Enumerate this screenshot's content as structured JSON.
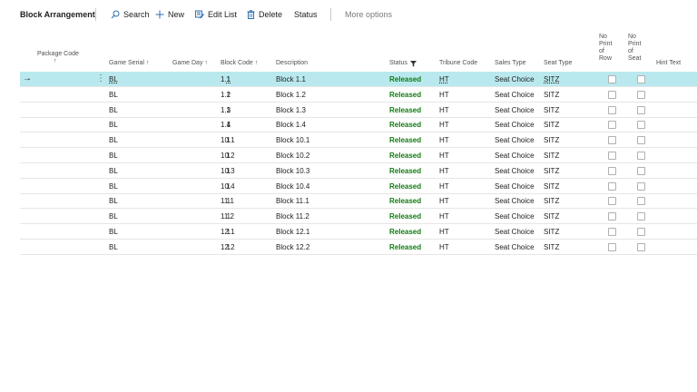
{
  "page": {
    "title": "Block Arrangement"
  },
  "toolbar": {
    "search_label": "Search",
    "new_label": "New",
    "edit_list_label": "Edit List",
    "delete_label": "Delete",
    "status_label": "Status",
    "more_options_label": "More options"
  },
  "colors": {
    "accent": "#2f6fb0",
    "selected_row": "#b9e9ee",
    "released": "#107c10"
  },
  "columns": {
    "package_code": "Package Code",
    "package_code_sort": "↑",
    "game_serial": "Game Serial ↑",
    "game_day": "Game Day ↑",
    "block_code": "Block Code ↑",
    "description": "Description",
    "status": "Status",
    "tribune_code": "Tribune Code",
    "sales_type": "Sales Type",
    "seat_type": "Seat Type",
    "no_print_row": [
      "No",
      "Print",
      "of",
      "Row"
    ],
    "no_print_seat": [
      "No",
      "Print",
      "of",
      "Seat"
    ],
    "hint_text": "Hint Text"
  },
  "rows": [
    {
      "serial": "BL",
      "day": "1",
      "block": "1.1",
      "desc": "Block 1.1",
      "status": "Released",
      "tribune": "HT",
      "sales": "Seat Choice",
      "seat": "SITZ"
    },
    {
      "serial": "BL",
      "day": "1",
      "block": "1.2",
      "desc": "Block 1.2",
      "status": "Released",
      "tribune": "HT",
      "sales": "Seat Choice",
      "seat": "SITZ"
    },
    {
      "serial": "BL",
      "day": "1",
      "block": "1.3",
      "desc": "Block 1.3",
      "status": "Released",
      "tribune": "HT",
      "sales": "Seat Choice",
      "seat": "SITZ"
    },
    {
      "serial": "BL",
      "day": "1",
      "block": "1.4",
      "desc": "Block 1.4",
      "status": "Released",
      "tribune": "HT",
      "sales": "Seat Choice",
      "seat": "SITZ"
    },
    {
      "serial": "BL",
      "day": "1",
      "block": "10.1",
      "desc": "Block 10.1",
      "status": "Released",
      "tribune": "HT",
      "sales": "Seat Choice",
      "seat": "SITZ"
    },
    {
      "serial": "BL",
      "day": "1",
      "block": "10.2",
      "desc": "Block 10.2",
      "status": "Released",
      "tribune": "HT",
      "sales": "Seat Choice",
      "seat": "SITZ"
    },
    {
      "serial": "BL",
      "day": "1",
      "block": "10.3",
      "desc": "Block 10.3",
      "status": "Released",
      "tribune": "HT",
      "sales": "Seat Choice",
      "seat": "SITZ"
    },
    {
      "serial": "BL",
      "day": "1",
      "block": "10.4",
      "desc": "Block 10.4",
      "status": "Released",
      "tribune": "HT",
      "sales": "Seat Choice",
      "seat": "SITZ"
    },
    {
      "serial": "BL",
      "day": "1",
      "block": "11.1",
      "desc": "Block 11.1",
      "status": "Released",
      "tribune": "HT",
      "sales": "Seat Choice",
      "seat": "SITZ"
    },
    {
      "serial": "BL",
      "day": "1",
      "block": "11.2",
      "desc": "Block 11.2",
      "status": "Released",
      "tribune": "HT",
      "sales": "Seat Choice",
      "seat": "SITZ"
    },
    {
      "serial": "BL",
      "day": "1",
      "block": "12.1",
      "desc": "Block 12.1",
      "status": "Released",
      "tribune": "HT",
      "sales": "Seat Choice",
      "seat": "SITZ"
    },
    {
      "serial": "BL",
      "day": "1",
      "block": "12.2",
      "desc": "Block 12.2",
      "status": "Released",
      "tribune": "HT",
      "sales": "Seat Choice",
      "seat": "SITZ"
    }
  ]
}
